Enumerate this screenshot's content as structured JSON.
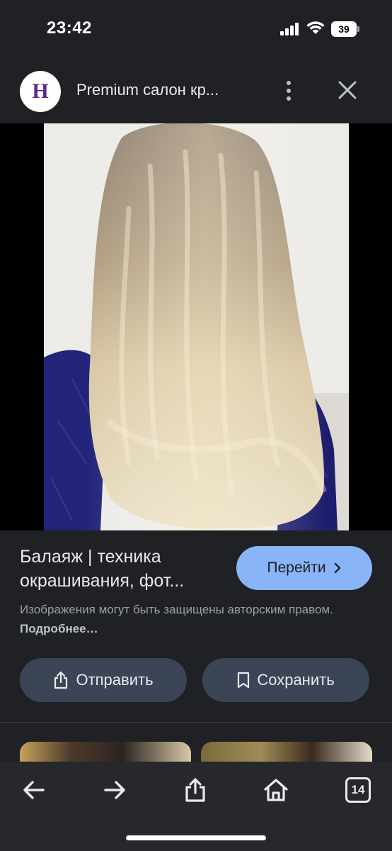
{
  "status_bar": {
    "time": "23:42",
    "battery": "39"
  },
  "header": {
    "logo_letter": "H",
    "title": "Premium салон кр..."
  },
  "image": {
    "subject": "hair-balayage-photo"
  },
  "info": {
    "caption_line1": "Балаяж | техника",
    "caption_line2": "окрашивания, фот...",
    "go_button": "Перейти",
    "copyright_text": "Изображения могут быть защищены авторским правом.",
    "copyright_more": "Подробнее…"
  },
  "actions": {
    "share_label": "Отправить",
    "save_label": "Сохранить"
  },
  "toolbar": {
    "tabs_count": "14"
  },
  "colors": {
    "background": "#202124",
    "accent_button": "#8ab4f8",
    "pill_button": "#3c4555",
    "toolbar": "#27282b"
  },
  "icons": [
    "signal-icon",
    "wifi-icon",
    "battery-icon",
    "more-vert-icon",
    "close-icon",
    "share-icon",
    "bookmark-icon",
    "back-arrow-icon",
    "forward-arrow-icon",
    "home-icon",
    "tabs-icon",
    "chevron-right-icon"
  ]
}
